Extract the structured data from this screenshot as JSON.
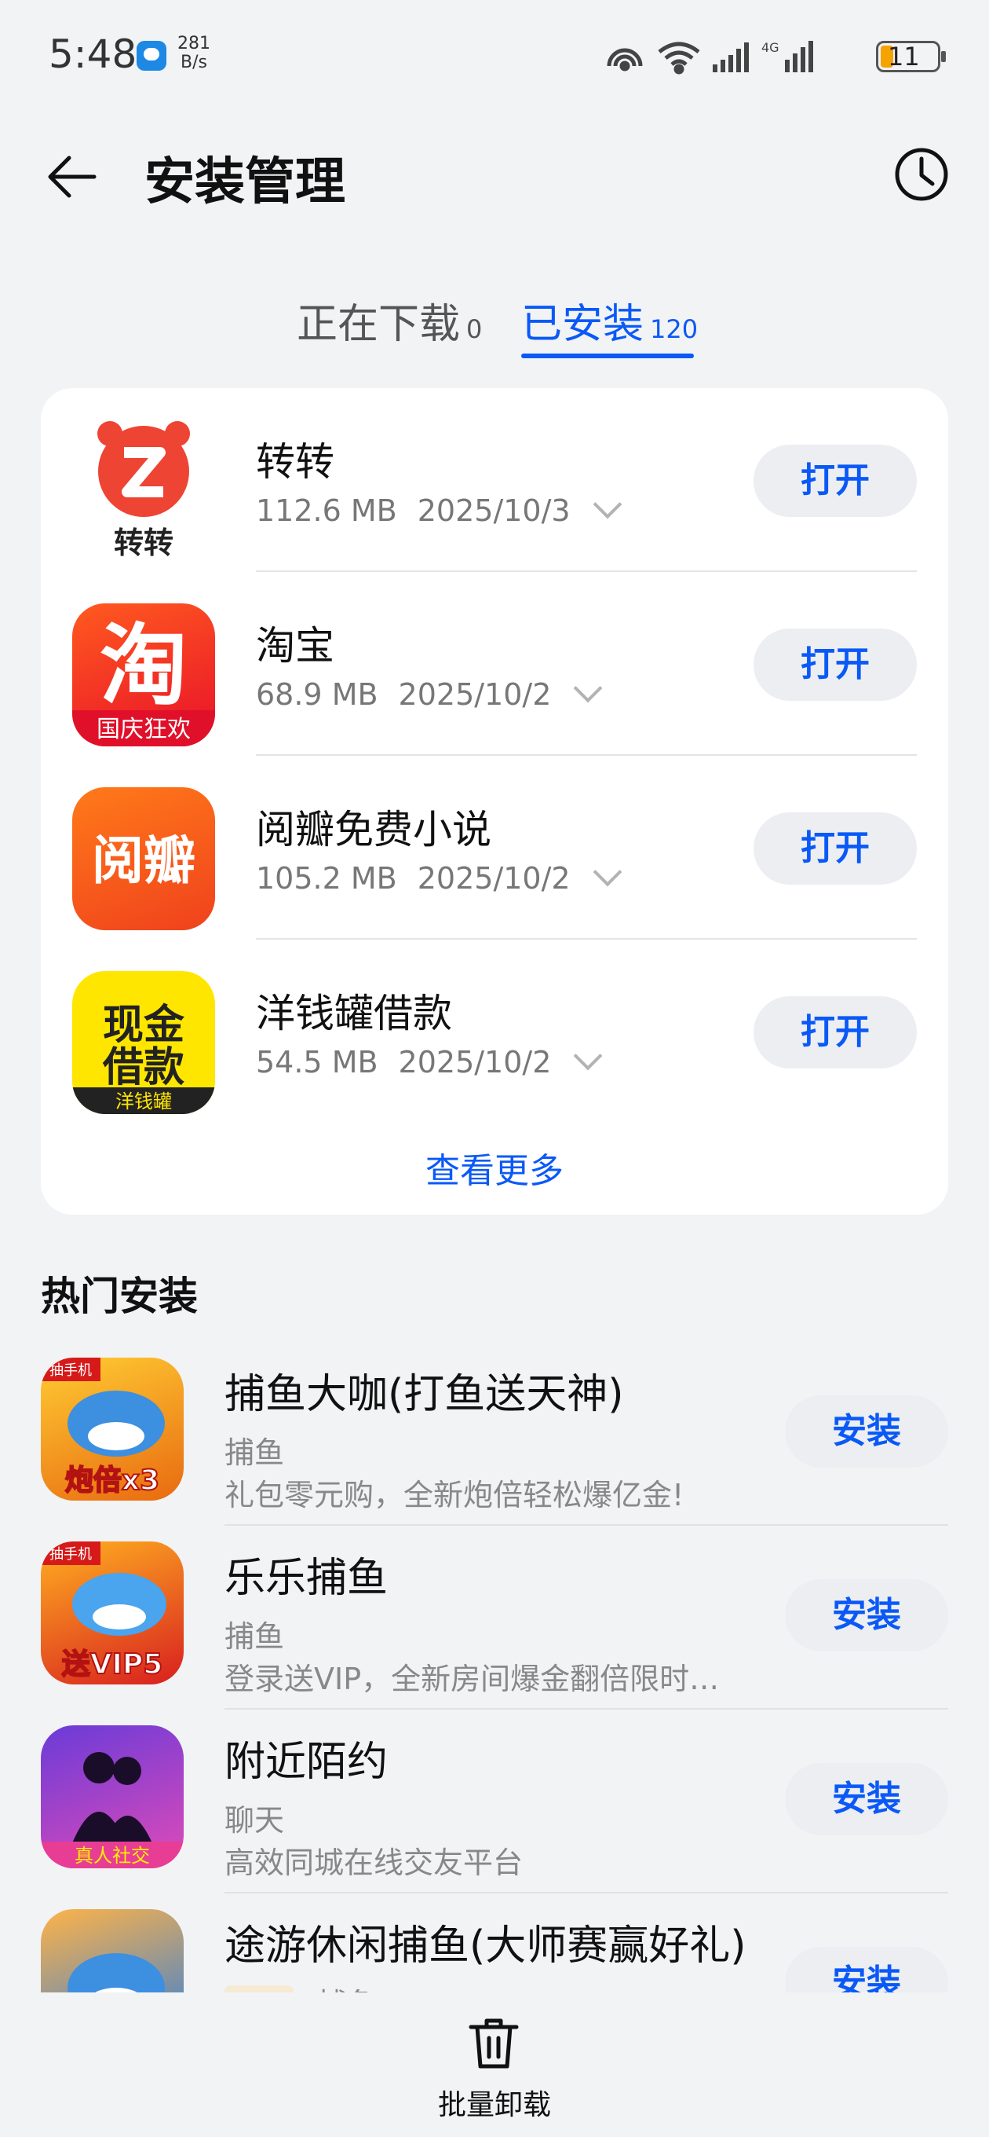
{
  "status_bar": {
    "time": "5:48",
    "net_speed_value": "281",
    "net_speed_unit": "B/s",
    "battery": "11"
  },
  "header": {
    "title": "安装管理"
  },
  "tabs": [
    {
      "label": "正在下载",
      "count": "0"
    },
    {
      "label": "已安装",
      "count": "120"
    }
  ],
  "installed": [
    {
      "name": "转转",
      "size": "112.6 MB",
      "date": "2025/10/3",
      "button": "打开",
      "icon_text": "转转"
    },
    {
      "name": "淘宝",
      "size": "68.9 MB",
      "date": "2025/10/2",
      "button": "打开",
      "icon_text": "淘",
      "icon_sub": "国庆狂欢"
    },
    {
      "name": "阅瓣免费小说",
      "size": "105.2 MB",
      "date": "2025/10/2",
      "button": "打开",
      "icon_text": "阅瓣"
    },
    {
      "name": "洋钱罐借款",
      "size": "54.5 MB",
      "date": "2025/10/2",
      "button": "打开",
      "icon_text": "现金借款",
      "icon_sub": "洋钱罐"
    }
  ],
  "see_more": "查看更多",
  "hot": {
    "title": "热门安装",
    "items": [
      {
        "name": "捕鱼大咖(打鱼送天神)",
        "category": "捕鱼",
        "desc": "礼包零元购，全新炮倍轻松爆亿金!",
        "button": "安装",
        "icon_text": "炮倍x3",
        "icon_tag": "抽手机"
      },
      {
        "name": "乐乐捕鱼",
        "category": "捕鱼",
        "desc": "登录送VIP，全新房间爆金翻倍限时…",
        "button": "安装",
        "icon_text": "送VIP5",
        "icon_tag": "抽手机"
      },
      {
        "name": "附近陌约",
        "category": "聊天",
        "desc": "高效同城在线交友平台",
        "button": "安装",
        "icon_text": "真人社交"
      },
      {
        "name": "途游休闲捕鱼(大师赛赢好礼)",
        "badge": "推荐",
        "category": "捕鱼",
        "button": "安装"
      }
    ]
  },
  "bottom": {
    "label": "批量卸载"
  },
  "colors": {
    "accent": "#0a59f7",
    "background": "#f1f3f5",
    "card": "#ffffff"
  }
}
